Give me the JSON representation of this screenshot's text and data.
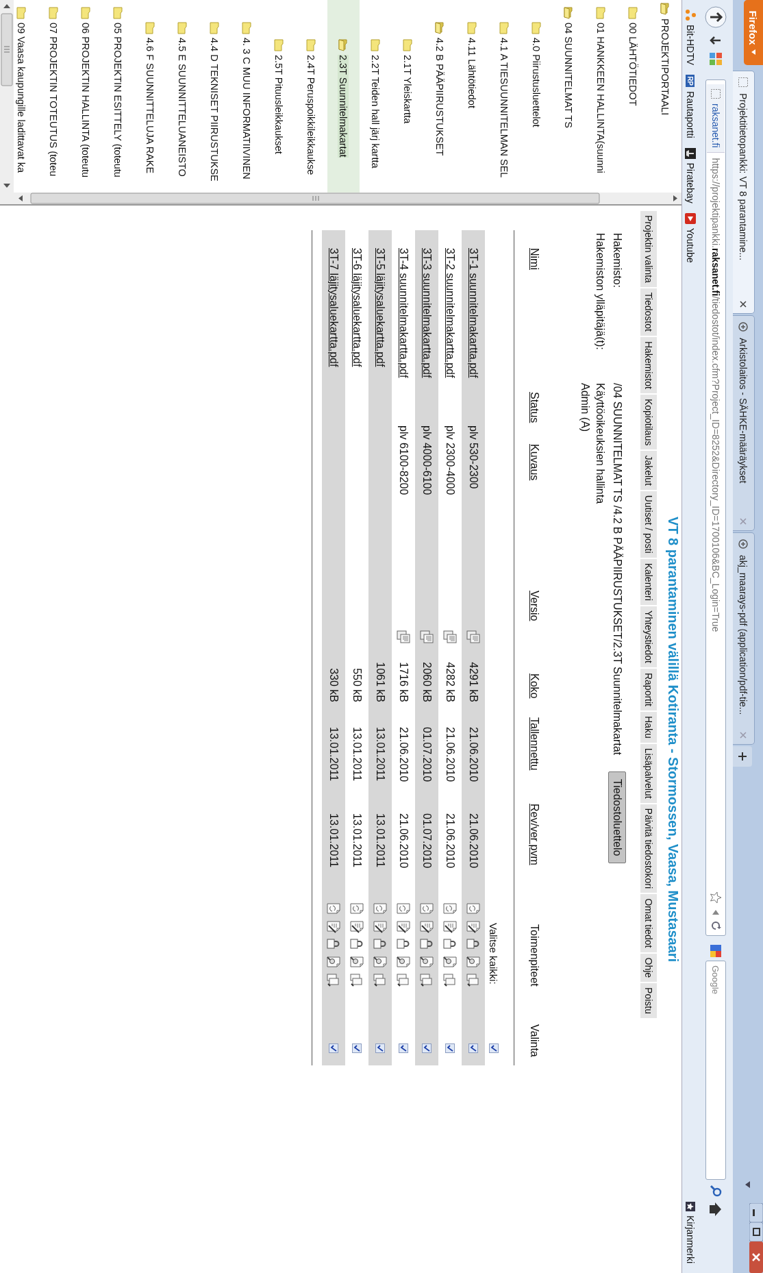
{
  "browser": {
    "menu_button": "Firefox",
    "tabs": [
      {
        "title": "Projektitietopankki: VT 8 parantamine...",
        "selected": true
      },
      {
        "title": "Arkistolaitos - SÄHKE-määräykset",
        "selected": false
      },
      {
        "title": "akj_maarays-pdf (application/pdf-tie...",
        "selected": false
      }
    ],
    "identity": "raksanet.fi",
    "url": "https://projektipankki.**raksanet.fi**/tiedostot/index.cfm?Project_ID=8252&Directory_ID=1700106&BC_Login=True",
    "search_placeholder": "Google",
    "bookmarks": [
      {
        "label": "Bit-HDTV"
      },
      {
        "label": "Rautaportti",
        "badge": "RP"
      },
      {
        "label": "Piratebay"
      },
      {
        "label": "Youtube"
      }
    ],
    "bookmarks_menu": "Kirjanmerki"
  },
  "tree": [
    {
      "label": "PROJEKTIPORTAALI",
      "expanded": true,
      "selected": false,
      "children": [
        {
          "label": "00 LÄHTÖTIEDOT",
          "expanded": false,
          "selected": false
        },
        {
          "label": "01 HANKKEEN HALLINTA(suunni",
          "expanded": false,
          "selected": false
        },
        {
          "label": "04 SUUNNITELMAT TS",
          "expanded": true,
          "selected": false,
          "children": [
            {
              "label": "4.0 Piirustusluettelot",
              "expanded": false,
              "selected": false
            },
            {
              "label": "4.1 A TIESUUNNITELMAN SEL",
              "expanded": false,
              "selected": false
            },
            {
              "label": "4.11 Lähtötiedot",
              "expanded": false,
              "selected": false
            },
            {
              "label": "4.2 B PÄÄPIIRUSTUKSET",
              "expanded": true,
              "selected": false,
              "children": [
                {
                  "label": "2.1T Yleiskartta",
                  "expanded": false,
                  "selected": false
                },
                {
                  "label": "2.2T Teiden hall järj kartta",
                  "expanded": false,
                  "selected": false
                },
                {
                  "label": "2.3T Suunnitelmakartat",
                  "expanded": true,
                  "selected": true
                },
                {
                  "label": "2.4T Peruspoikkileikkaukse",
                  "expanded": false,
                  "selected": false
                },
                {
                  "label": "2.5T Pituusleikkaukset",
                  "expanded": false,
                  "selected": false
                }
              ]
            },
            {
              "label": "4. 3 C MUU INFORMATIIVINEN",
              "expanded": false,
              "selected": false
            },
            {
              "label": "4.4 D TEKNISET PIIRUSTUKSE",
              "expanded": false,
              "selected": false
            },
            {
              "label": "4.5 E SUUNNITTELUANEISTO",
              "expanded": false,
              "selected": false
            },
            {
              "label": "4.6 F SUUNNITTELUJA RAKE",
              "expanded": false,
              "selected": false
            }
          ]
        },
        {
          "label": "05 PROJEKTIN ESITTELY (toteutu",
          "expanded": false,
          "selected": false
        },
        {
          "label": "06 PROJEKTIN HALLINTA (toteutu",
          "expanded": false,
          "selected": false
        },
        {
          "label": "07 PROJEKTIN TOTEUTUS (toteu",
          "expanded": false,
          "selected": false
        },
        {
          "label": "09 Vaasa kaupungille ladittavat ka",
          "expanded": false,
          "selected": false
        }
      ]
    }
  ],
  "page": {
    "title": "VT 8 parantaminen välillä Kotiranta - Stormossen, Vaasa, Mustasaari",
    "menu": [
      "Projektin valinta",
      "Tiedostot",
      "Hakemistot",
      "Kopiotilaus",
      "Jakelut",
      "Uutiset / posti",
      "Kalenteri",
      "Yhteystiedot",
      "Raportit",
      "Haku",
      "Lisäpalvelut",
      "Päivitä tiedostokori",
      "Omat tiedot",
      "Ohje",
      "Poistu"
    ],
    "directory_label": "Hakemisto:",
    "directory_path": "/04 SUUNNITELMAT TS /4.2 B PÄÄPIIRUSTUKSET/2.3T Suunnitelmakartat",
    "list_button": "Tiedostoluettelo",
    "admins_label": "Hakemiston ylläpitäjä(t):",
    "admins_link": "Käyttöoikeuksien hallinta",
    "admin_name": "Admin (A)",
    "columns": [
      {
        "label": "Nimi",
        "sortable": true
      },
      {
        "label": "Status",
        "sortable": true
      },
      {
        "label": "Kuvaus",
        "sortable": true
      },
      {
        "label": "Versio",
        "sortable": true
      },
      {
        "label": "Koko",
        "sortable": true
      },
      {
        "label": "Tallennettu",
        "sortable": true
      },
      {
        "label": "Rev/ver pvm",
        "sortable": true
      },
      {
        "label": "Toimenpiteet",
        "sortable": false
      },
      {
        "label": "Valinta",
        "sortable": false
      }
    ],
    "select_all": {
      "label": "Valitse kaikki:",
      "checked": true
    },
    "rows": [
      {
        "name": "3T-1 suunnitelmakartta.pdf",
        "description": "plv 530-2300",
        "versions": true,
        "size": "4291 kB",
        "saved": "21.06.2010",
        "revised": "21.06.2010",
        "selected": true
      },
      {
        "name": "3T-2 suunnitelmakartta.pdf",
        "description": "plv 2300-4000",
        "versions": true,
        "size": "4282 kB",
        "saved": "21.06.2010",
        "revised": "21.06.2010",
        "selected": true
      },
      {
        "name": "3T-3 suunnitelmakartta.pdf",
        "description": "plv 4000-6100",
        "versions": true,
        "size": "2060 kB",
        "saved": "01.07.2010",
        "revised": "01.07.2010",
        "selected": true
      },
      {
        "name": "3T-4 suunnitelmakartta.pdf",
        "description": "plv 6100-8200",
        "versions": true,
        "size": "1716 kB",
        "saved": "21.06.2010",
        "revised": "21.06.2010",
        "selected": true
      },
      {
        "name": "3T-5 läjitysaluekartta.pdf",
        "versions": false,
        "size": "1061 kB",
        "saved": "13.01.2011",
        "revised": "13.01.2011",
        "selected": true
      },
      {
        "name": "3T-6 läjitysaluekartta.pdf",
        "versions": false,
        "size": "550 kB",
        "saved": "13.01.2011",
        "revised": "13.01.2011",
        "selected": true
      },
      {
        "name": "3T-7 läjitysaluekartta.pdf",
        "versions": false,
        "size": "330 kB",
        "saved": "13.01.2011",
        "revised": "13.01.2011",
        "selected": true
      }
    ]
  }
}
